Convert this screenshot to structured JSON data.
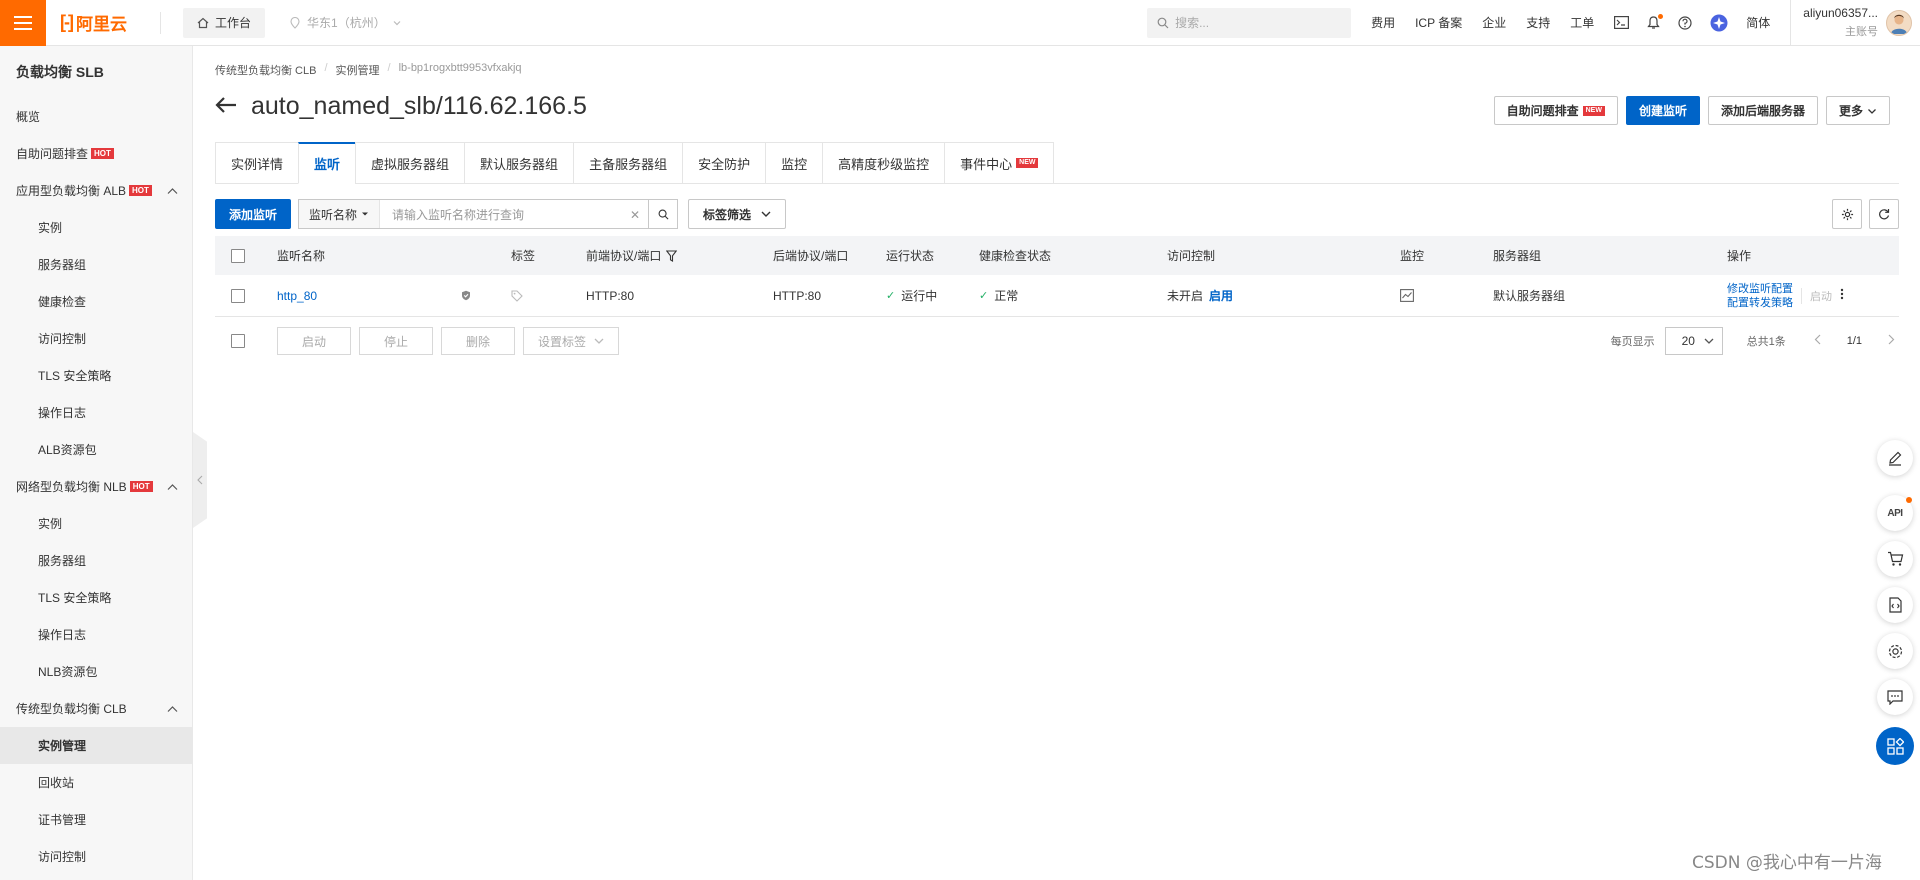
{
  "topbar": {
    "logo": "阿里云",
    "workbench": "工作台",
    "region": "华东1（杭州）",
    "search_placeholder": "搜索...",
    "links": [
      "费用",
      "ICP 备案",
      "企业",
      "支持",
      "工单"
    ],
    "lang": "简体",
    "user_name": "aliyun06357...",
    "user_role": "主账号"
  },
  "sidebar": {
    "title": "负载均衡 SLB",
    "hot": "HOT",
    "items": [
      {
        "label": "概览",
        "level": 0
      },
      {
        "label": "自助问题排查",
        "level": 0,
        "hot": true
      },
      {
        "label": "应用型负载均衡 ALB",
        "level": 0,
        "hot": true,
        "group": true
      },
      {
        "label": "实例",
        "level": 1
      },
      {
        "label": "服务器组",
        "level": 1
      },
      {
        "label": "健康检查",
        "level": 1
      },
      {
        "label": "访问控制",
        "level": 1
      },
      {
        "label": "TLS 安全策略",
        "level": 1
      },
      {
        "label": "操作日志",
        "level": 1
      },
      {
        "label": "ALB资源包",
        "level": 1
      },
      {
        "label": "网络型负载均衡 NLB",
        "level": 0,
        "hot": true,
        "group": true
      },
      {
        "label": "实例",
        "level": 1
      },
      {
        "label": "服务器组",
        "level": 1
      },
      {
        "label": "TLS 安全策略",
        "level": 1
      },
      {
        "label": "操作日志",
        "level": 1
      },
      {
        "label": "NLB资源包",
        "level": 1
      },
      {
        "label": "传统型负载均衡 CLB",
        "level": 0,
        "group": true
      },
      {
        "label": "实例管理",
        "level": 1,
        "active": true
      },
      {
        "label": "回收站",
        "level": 1
      },
      {
        "label": "证书管理",
        "level": 1
      },
      {
        "label": "访问控制",
        "level": 1
      }
    ]
  },
  "breadcrumb": [
    "传统型负载均衡 CLB",
    "实例管理",
    "lb-bp1rogxbtt9953vfxakjq"
  ],
  "page": {
    "title": "auto_named_slb/116.62.166.5",
    "actions": {
      "troubleshoot": "自助问题排查",
      "new": "NEW",
      "create_listener": "创建监听",
      "add_backend": "添加后端服务器",
      "more": "更多"
    }
  },
  "tabs": [
    {
      "label": "实例详情"
    },
    {
      "label": "监听",
      "active": true
    },
    {
      "label": "虚拟服务器组"
    },
    {
      "label": "默认服务器组"
    },
    {
      "label": "主备服务器组"
    },
    {
      "label": "安全防护"
    },
    {
      "label": "监控"
    },
    {
      "label": "高精度秒级监控"
    },
    {
      "label": "事件中心",
      "new": true
    }
  ],
  "toolbar": {
    "add_listener": "添加监听",
    "search_field": "监听名称",
    "search_placeholder": "请输入监听名称进行查询",
    "tag_filter": "标签筛选"
  },
  "table": {
    "headers": {
      "name": "监听名称",
      "tag": "标签",
      "frontend": "前端协议/端口",
      "backend": "后端协议/端口",
      "status": "运行状态",
      "health": "健康检查状态",
      "acl": "访问控制",
      "monitor": "监控",
      "server_group": "服务器组",
      "ops": "操作"
    },
    "rows": [
      {
        "name": "http_80",
        "frontend": "HTTP:80",
        "backend": "HTTP:80",
        "status": "运行中",
        "health": "正常",
        "acl": "未开启",
        "acl_action": "启用",
        "server_group": "默认服务器组",
        "op_edit": "修改监听配置",
        "op_forward": "配置转发策略",
        "op_start": "启动"
      }
    ]
  },
  "footer": {
    "buttons": [
      "启动",
      "停止",
      "删除",
      "设置标签"
    ],
    "per_page_label": "每页显示",
    "per_page": "20",
    "total": "总共1条",
    "page": "1/1"
  },
  "float_api": "API",
  "watermark": "CSDN @我心中有一片海"
}
